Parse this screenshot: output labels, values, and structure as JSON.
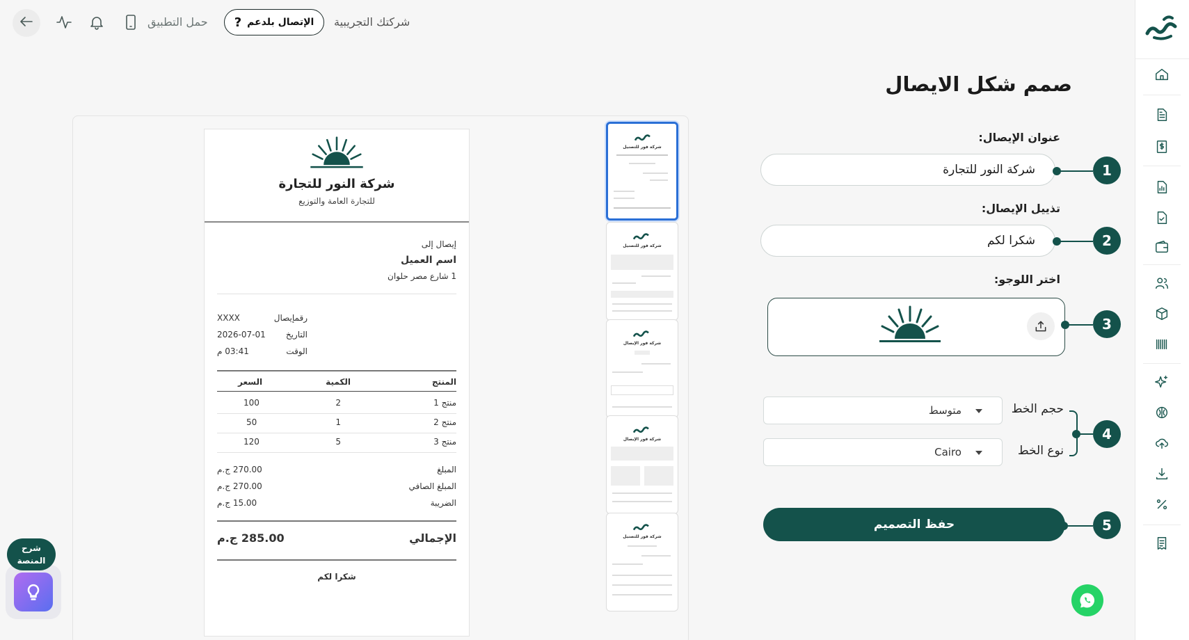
{
  "topbar": {
    "company_name": "شركتك التجريبية",
    "support_label": "الإتصال بلدعم",
    "download_app_label": "حمل التطبيق"
  },
  "form": {
    "page_title": "صمم شكل الايصال",
    "receipt_title_label": "عنوان الإيصال:",
    "receipt_title_value": "شركة النور للتجارة",
    "receipt_footer_label": "تذييل الإيصال:",
    "receipt_footer_value": "شكرا لكم",
    "logo_label": "اختر اللوجو:",
    "font_size_label": "حجم الخط",
    "font_size_value": "متوسط",
    "font_type_label": "نوع الخط",
    "font_type_value": "Cairo",
    "save_label": "حفظ التصميم",
    "steps": [
      "1",
      "2",
      "3",
      "4",
      "5"
    ]
  },
  "receipt": {
    "company": "شركة النور للتجارة",
    "tagline": "للتجارة العامة والتوزيع",
    "to_label": "إيصال إلى",
    "customer_name": "اسم العميل",
    "customer_address": "1 شارع مصر حلوان",
    "receipt_no_label": "رقمإيصال",
    "receipt_no_value": "XXXX",
    "date_label": "التاريخ",
    "date_value": "2026-07-01",
    "time_label": "الوقت",
    "time_value": "03:41 م",
    "columns": [
      "المنتج",
      "الكمية",
      "السعر"
    ],
    "rows": [
      {
        "product": "منتج 1",
        "qty": "2",
        "price": "100"
      },
      {
        "product": "منتج 2",
        "qty": "1",
        "price": "50"
      },
      {
        "product": "منتج 3",
        "qty": "5",
        "price": "120"
      }
    ],
    "amount_label": "المبلغ",
    "amount_value": "270.00 ج.م",
    "net_label": "المبلغ الصافي",
    "net_value": "270.00 ج.م",
    "tax_label": "الضريبة",
    "tax_value": "15.00 ج.م",
    "total_label": "الإجمالي",
    "total_value": "285.00 ج.م",
    "footer": "شكرا لكم"
  },
  "thumbnails": [
    {
      "title": "شركة فور للتصنيل"
    },
    {
      "title": "شركة فور للتصنيل"
    },
    {
      "title": "شركة فور الإيصال"
    },
    {
      "title": "شركة فور الإيصال"
    },
    {
      "title": "شركة فور للتصنيل"
    }
  ],
  "help": {
    "label_line1": "شرح",
    "label_line2": "المنصة"
  },
  "colors": {
    "brand": "#14524b",
    "selected_thumb": "#2a6fd6",
    "whatsapp": "#25d366"
  }
}
